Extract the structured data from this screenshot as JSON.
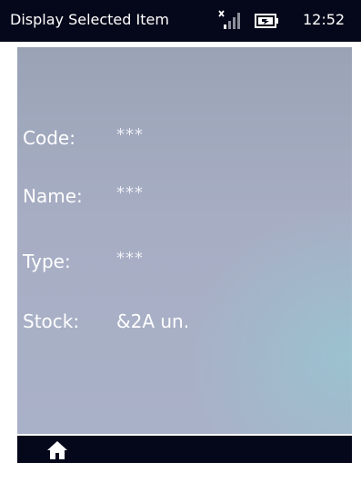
{
  "titlebar": {
    "title": "Display Selected Item",
    "time": "12:52"
  },
  "icons": {
    "signal": "signal-icon",
    "battery": "battery-icon",
    "home": "home-icon"
  },
  "fields": {
    "code": {
      "label": "Code:",
      "value": "***"
    },
    "name": {
      "label": "Name:",
      "value": "***"
    },
    "type": {
      "label": "Type:",
      "value": "***"
    },
    "stock": {
      "label": "Stock:",
      "value": "&2A un."
    }
  },
  "colors": {
    "bar_background": "#05081a",
    "content_gradient_top": "#9aa3b6",
    "content_accent": "#96c8d2",
    "text": "#ffffff"
  }
}
